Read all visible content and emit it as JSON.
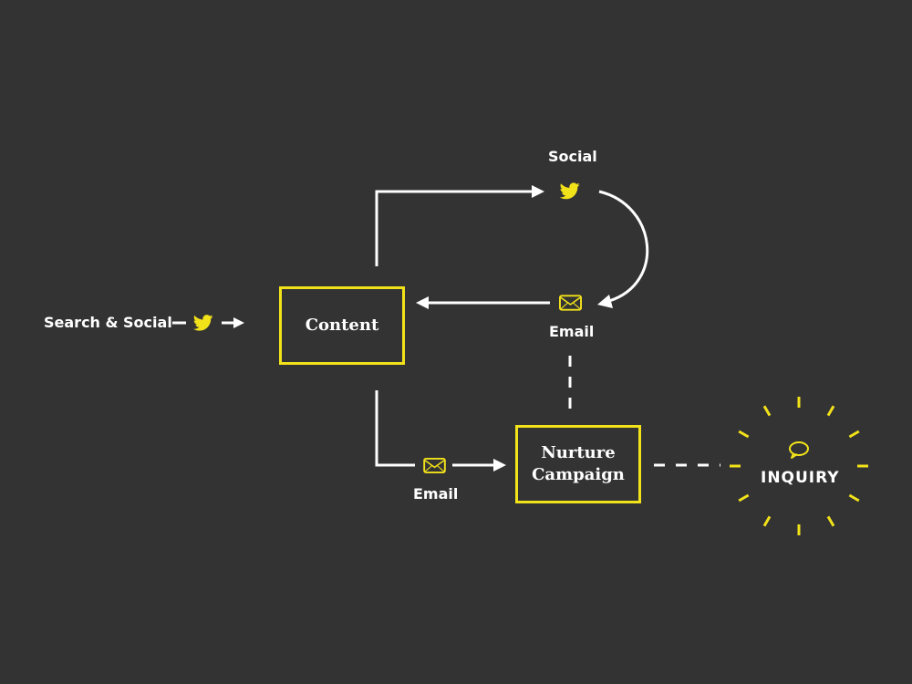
{
  "colors": {
    "background": "#333333",
    "accent": "#f2e21a",
    "line": "#ffffff"
  },
  "labels": {
    "search_social": "Search & Social",
    "social": "Social",
    "email_top": "Email",
    "email_bottom": "Email",
    "inquiry": "INQUIRY"
  },
  "nodes": {
    "content": "Content",
    "nurture_line1": "Nurture",
    "nurture_line2": "Campaign"
  },
  "icons": {
    "search_social": "twitter-bird-icon",
    "social": "twitter-bird-icon",
    "email_top": "envelope-icon",
    "email_bottom": "envelope-icon",
    "inquiry": "speech-bubble-icon"
  }
}
